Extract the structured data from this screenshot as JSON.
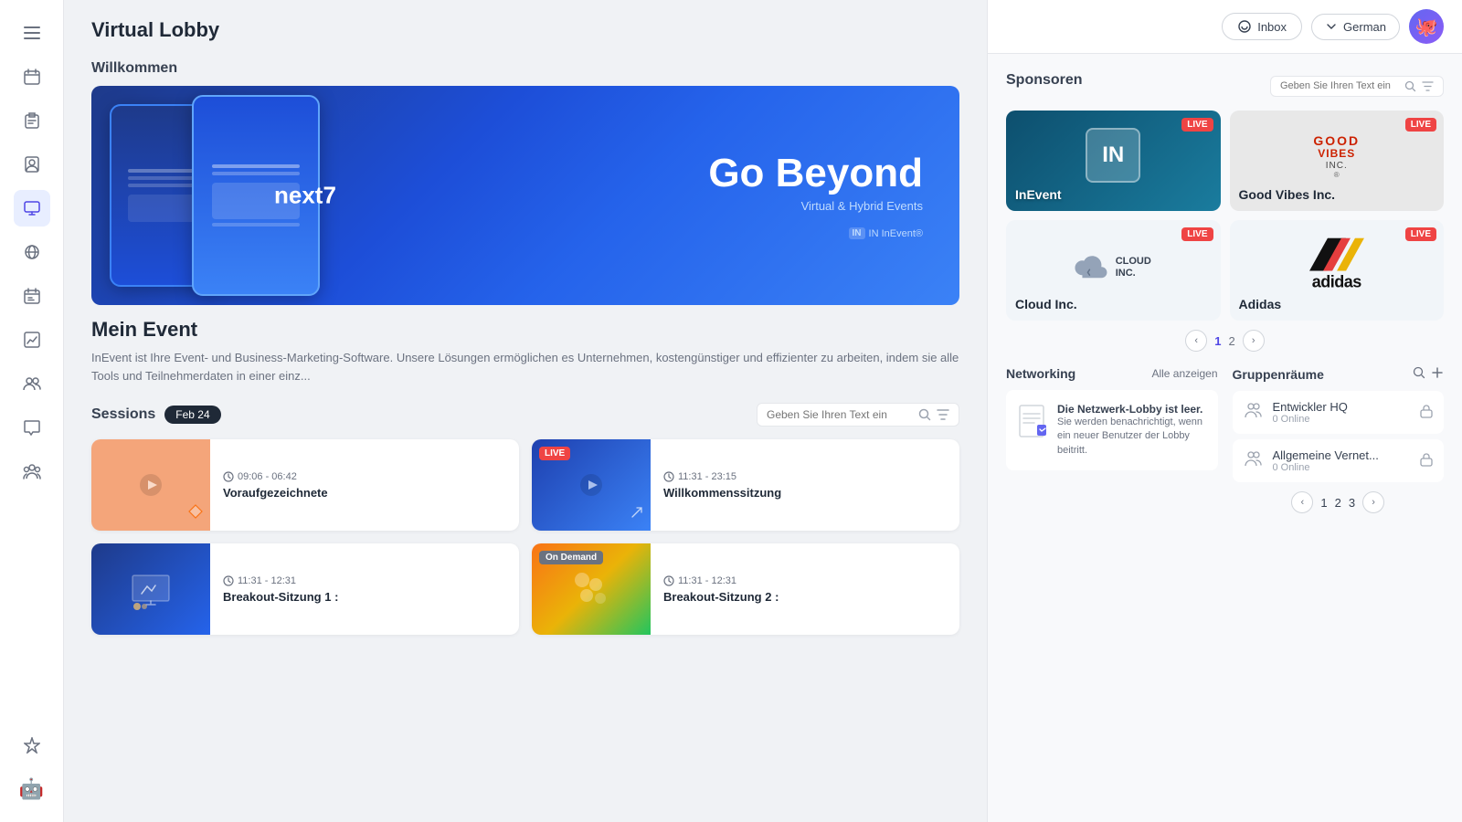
{
  "app": {
    "title": "Virtual Lobby"
  },
  "sidebar": {
    "items": [
      {
        "id": "menu",
        "icon": "☰",
        "label": "Menu"
      },
      {
        "id": "calendar",
        "icon": "📅",
        "label": "Calendar"
      },
      {
        "id": "clipboard",
        "icon": "📋",
        "label": "Clipboard"
      },
      {
        "id": "person",
        "icon": "🪪",
        "label": "Profile"
      },
      {
        "id": "monitor",
        "icon": "🖥",
        "label": "Virtual Lobby"
      },
      {
        "id": "network",
        "icon": "🔗",
        "label": "Network"
      },
      {
        "id": "calendar2",
        "icon": "📆",
        "label": "Schedule"
      },
      {
        "id": "chart",
        "icon": "📊",
        "label": "Analytics"
      },
      {
        "id": "team",
        "icon": "👥",
        "label": "Team"
      },
      {
        "id": "chat",
        "icon": "💬",
        "label": "Chat"
      },
      {
        "id": "group",
        "icon": "👨‍👩‍👧",
        "label": "Group"
      },
      {
        "id": "diamond",
        "icon": "💎",
        "label": "Rewards"
      },
      {
        "id": "bot",
        "icon": "🤖",
        "label": "Bot"
      }
    ]
  },
  "header": {
    "inbox_label": "Inbox",
    "language_label": "German",
    "avatar_emoji": "🐙"
  },
  "welcome": {
    "section_label": "Willkommen",
    "hero_main_text": "Go Beyond",
    "hero_sub_text": "Virtual & Hybrid Events",
    "hero_brand": "IN InEvent®",
    "next_label": "next7",
    "event_title": "Mein Event",
    "event_desc": "InEvent ist Ihre Event- und Business-Marketing-Software. Unsere Lösungen ermöglichen es Unternehmen, kostengünstiger und effizienter zu arbeiten, indem sie alle Tools und Teilnehmerdaten in einer einz..."
  },
  "sessions": {
    "label": "Sessions",
    "date_badge": "Feb 24",
    "search_placeholder": "Geben Sie Ihren Text ein",
    "items": [
      {
        "id": 1,
        "thumb_type": "orange",
        "status": "",
        "time": "09:06 - 06:42",
        "name": "Voraufgezeichnete"
      },
      {
        "id": 2,
        "thumb_type": "blue",
        "status": "LIVE",
        "time": "11:31 - 23:15",
        "name": "Willkommenssitzung"
      },
      {
        "id": 3,
        "thumb_type": "dark-blue",
        "status": "",
        "time": "11:31 - 12:31",
        "name": "Breakout-Sitzung 1 :"
      },
      {
        "id": 4,
        "thumb_type": "colorful",
        "status": "On Demand",
        "time": "11:31 - 12:31",
        "name": "Breakout-Sitzung 2 :"
      }
    ]
  },
  "sponsors": {
    "label": "Sponsoren",
    "search_placeholder": "Geben Sie Ihren Text ein",
    "items": [
      {
        "id": "inevent",
        "name": "InEvent",
        "status": "LIVE",
        "type": "inevent"
      },
      {
        "id": "goodvibes",
        "name": "Good Vibes Inc.",
        "status": "LIVE",
        "type": "goodvibes"
      },
      {
        "id": "cloud",
        "name": "Cloud Inc.",
        "status": "LIVE",
        "type": "cloud"
      },
      {
        "id": "adidas",
        "name": "Adidas",
        "status": "LIVE",
        "type": "adidas"
      }
    ],
    "pagination": {
      "current": 1,
      "total": 2
    }
  },
  "networking": {
    "label": "Networking",
    "link_label": "Alle anzeigen",
    "empty_title": "Die Netzwerk-Lobby ist leer.",
    "empty_desc": "Sie werden benachrichtigt, wenn ein neuer Benutzer der Lobby beitritt."
  },
  "gruppenraume": {
    "label": "Gruppenräume",
    "rooms": [
      {
        "id": 1,
        "name": "Entwickler HQ",
        "online": "0 Online",
        "locked": true
      },
      {
        "id": 2,
        "name": "Allgemeine Vernet...",
        "online": "0 Online",
        "locked": true
      }
    ],
    "pagination": {
      "current": 1,
      "pages": [
        1,
        2,
        3
      ]
    }
  }
}
